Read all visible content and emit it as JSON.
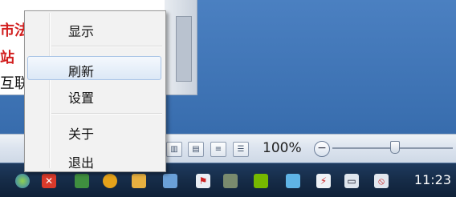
{
  "window_fragments": [
    "市法",
    "站",
    "互联"
  ],
  "context_menu": {
    "items": [
      {
        "label": "显示",
        "highlighted": false
      },
      {
        "label": "刷新",
        "highlighted": true
      },
      {
        "label": "设置",
        "highlighted": false
      },
      {
        "label": "关于",
        "highlighted": false
      },
      {
        "label": "退出",
        "highlighted": false
      }
    ]
  },
  "status_bar": {
    "zoom_label": "100%",
    "zoom_minus": "−",
    "view_icons": [
      "reading-view-icon",
      "web-layout-icon",
      "outline-view-icon",
      "draft-view-icon"
    ]
  },
  "taskbar": {
    "icons": [
      "app-icon-1",
      "close-app-icon",
      "app-icon-3",
      "app-icon-4",
      "app-icon-5",
      "app-icon-6",
      "flag-icon",
      "usb-icon",
      "nvidia-icon",
      "app-icon-10",
      "power-icon",
      "network-icon",
      "volume-muted-icon"
    ],
    "clock": "11:23"
  },
  "colors": {
    "desktop": "#3a6fb0",
    "highlight_border": "#a9c4e6",
    "accent_red": "#d21f1f"
  }
}
